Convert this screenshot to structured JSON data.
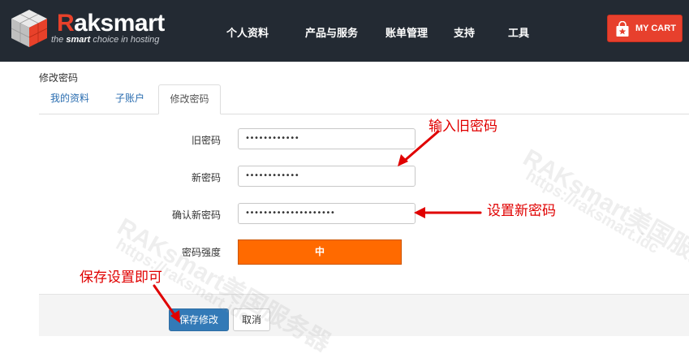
{
  "header": {
    "brand": "Raksmart",
    "tagline_pre": "the ",
    "tagline_bold": "smart",
    "tagline_post": " choice in hosting",
    "nav": [
      {
        "label": "个人资料"
      },
      {
        "label": "产品与服务"
      },
      {
        "label": "账单管理"
      },
      {
        "label": "支持"
      },
      {
        "label": "工具"
      }
    ],
    "cart_label": "MY CART"
  },
  "page": {
    "title": "修改密码",
    "tabs": [
      {
        "label": "我的资料"
      },
      {
        "label": "子账户"
      },
      {
        "label": "修改密码",
        "active": true
      }
    ]
  },
  "form": {
    "old_password": {
      "label": "旧密码",
      "value": "••••••••••••"
    },
    "new_password": {
      "label": "新密码",
      "value": "••••••••••••"
    },
    "confirm_password": {
      "label": "确认新密码",
      "value": "••••••••••••••••••••"
    },
    "strength": {
      "label": "密码强度",
      "value": "中"
    }
  },
  "actions": {
    "save": "保存修改",
    "cancel": "取消"
  },
  "annotations": {
    "old_password_hint": "输入旧密码",
    "new_password_hint": "设置新密码",
    "save_hint": "保存设置即可"
  },
  "watermark": {
    "line1": "RAKsmart美国服务器",
    "line2": "https://raksmart.idc"
  },
  "colors": {
    "header_bg": "#232a33",
    "brand_accent": "#e8412a",
    "cart_bg": "#e7402d",
    "strength_bar": "#ff6a00",
    "primary_button": "#337ab7",
    "annotation": "#e00000"
  }
}
